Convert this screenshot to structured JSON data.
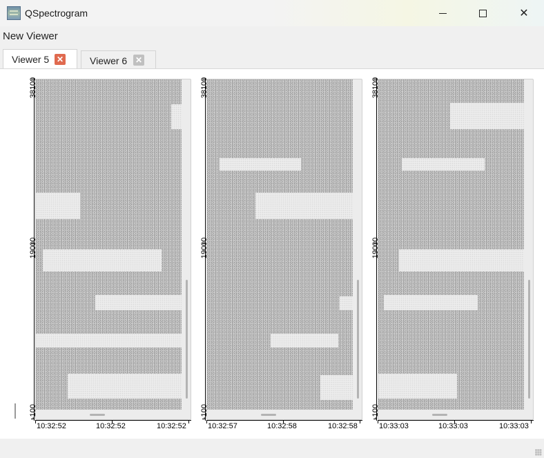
{
  "window": {
    "title": "QSpectrogram",
    "icon": "spectrogram-app-icon"
  },
  "menu": {
    "items": [
      "New Viewer"
    ]
  },
  "tabs": [
    {
      "label": "Viewer 5",
      "active": true,
      "close_icon": "close-icon"
    },
    {
      "label": "Viewer 6",
      "active": false,
      "close_icon": "close-icon"
    }
  ],
  "viewers": [
    {
      "y_ticks": [
        "38100",
        "19000",
        "-100"
      ],
      "x_ticks": [
        "10:32:52",
        "10:32:52",
        "10:32:52"
      ]
    },
    {
      "y_ticks": [
        "38100",
        "19000",
        "-100"
      ],
      "x_ticks": [
        "10:32:57",
        "10:32:58",
        "10:32:58"
      ]
    },
    {
      "y_ticks": [
        "38100",
        "19000",
        "-100"
      ],
      "x_ticks": [
        "10:33:03",
        "10:33:03",
        "10:33:03"
      ]
    }
  ],
  "colors": {
    "close_active": "#e06a4f",
    "close_inactive": "#c0c0c0",
    "spectrogram_bg": "#c4c4c4",
    "signal_band": "#ececec"
  }
}
